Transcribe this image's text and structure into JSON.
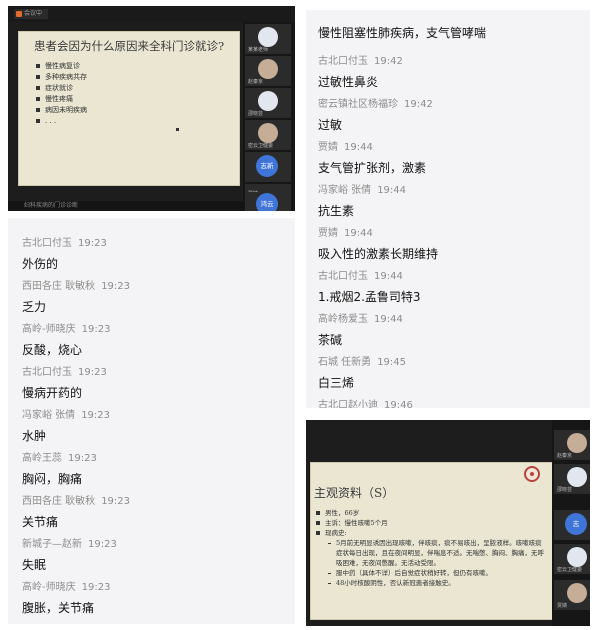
{
  "top_left_meeting": {
    "app_label": "会议中",
    "slide_title": "患者会因为什么原因来全科门诊就诊?",
    "bullets": [
      "慢性病复诊",
      "多种疾病共存",
      "症状就诊",
      "慢性疼痛",
      "病因未明疾病",
      ". . ."
    ],
    "bottom_text": "妇科疾病的门诊诊断",
    "participants": [
      {
        "name": "某某老师",
        "kind": "video"
      },
      {
        "name": "赵秦京",
        "kind": "video"
      },
      {
        "name": "邵晓芸",
        "kind": "video"
      },
      {
        "name": "密云卫健委",
        "kind": "video"
      },
      {
        "name": "志新",
        "kind": "avatar",
        "color": "#3f74d8"
      },
      {
        "name": "贾婧",
        "kind": "video"
      },
      {
        "name": "鸿云",
        "kind": "avatar",
        "color": "#3f74d8"
      }
    ]
  },
  "chat_left": {
    "messages": [
      {
        "sender": "古北口付玉",
        "time": "19:23",
        "text": "外伤的"
      },
      {
        "sender": "西田各庄 耿敏秋",
        "time": "19:23",
        "text": "乏力"
      },
      {
        "sender": "高岭-师晓庆",
        "time": "19:23",
        "text": "反酸，烧心"
      },
      {
        "sender": "古北口付玉",
        "time": "19:23",
        "text": "慢病开药的"
      },
      {
        "sender": "冯家峪 张倩",
        "time": "19:23",
        "text": "水肿"
      },
      {
        "sender": "高岭王蕊",
        "time": "19:23",
        "text": "胸闷，胸痛"
      },
      {
        "sender": "西田各庄 耿敏秋",
        "time": "19:23",
        "text": "关节痛"
      },
      {
        "sender": "新城子—赵新",
        "time": "19:23",
        "text": "失眠"
      },
      {
        "sender": "高岭-师晓庆",
        "time": "19:23",
        "text": "腹胀，关节痛"
      }
    ]
  },
  "chat_right": {
    "first_line": "慢性阻塞性肺疾病，支气管哮喘",
    "messages": [
      {
        "sender": "古北口付玉",
        "time": "19:42",
        "text": "过敏性鼻炎"
      },
      {
        "sender": "密云镇社区杨福珍",
        "time": "19:42",
        "text": "过敏"
      },
      {
        "sender": "贾婧",
        "time": "19:44",
        "text": "支气管扩张剂，激素"
      },
      {
        "sender": "冯家峪  张倩",
        "time": "19:44",
        "text": "抗生素"
      },
      {
        "sender": "贾婧",
        "time": "19:44",
        "text": "吸入性的激素长期维持"
      },
      {
        "sender": "古北口付玉",
        "time": "19:44",
        "text": "1.戒烟2.孟鲁司特3"
      },
      {
        "sender": "高岭杨爱玉",
        "time": "19:44",
        "text": "茶碱"
      },
      {
        "sender": "石城 任新勇",
        "time": "19:45",
        "text": "白三烯"
      },
      {
        "sender": "古北口赵小迪",
        "time": "19:46",
        "text": ""
      }
    ]
  },
  "bottom_right_meeting": {
    "slide_title": "主观资料（S）",
    "bullets": [
      {
        "text": "男性，66岁",
        "sub": false
      },
      {
        "text": "主诉：慢性咳嗽5个月",
        "sub": false
      },
      {
        "text": "现病史:",
        "sub": false
      },
      {
        "text": "5月前无明显诱因出现咳嗽，伴咳痰，痰不易咳出，呈脓液样。咳嗽咳痰症状每日出现，且在夜间明显，伴喘息不适。无喘憋、胸闷、胸痛，无呼吸困难，无夜间憋醒。无活动受限。",
        "sub": true
      },
      {
        "text": "服中药（具体不详）后自觉症状稍好转，但仍有咳嗽。",
        "sub": true
      },
      {
        "text": "48小时核酸阴性，否认新冠患者接触史。",
        "sub": true
      }
    ],
    "participants": [
      {
        "name": "赵秦京",
        "kind": "video"
      },
      {
        "name": "邵晓芸",
        "kind": "video"
      },
      {
        "name": "志",
        "kind": "avatar",
        "color": "#3f74d8"
      },
      {
        "name": "密云卫健委",
        "kind": "video"
      },
      {
        "name": "贾婧",
        "kind": "video"
      }
    ]
  },
  "colors": {
    "chat_bg": "#f4f4f6",
    "meeting_bg": "#1d1d1d",
    "slide_bg": "#eae6d2",
    "avatar_blue": "#3f74d8"
  }
}
